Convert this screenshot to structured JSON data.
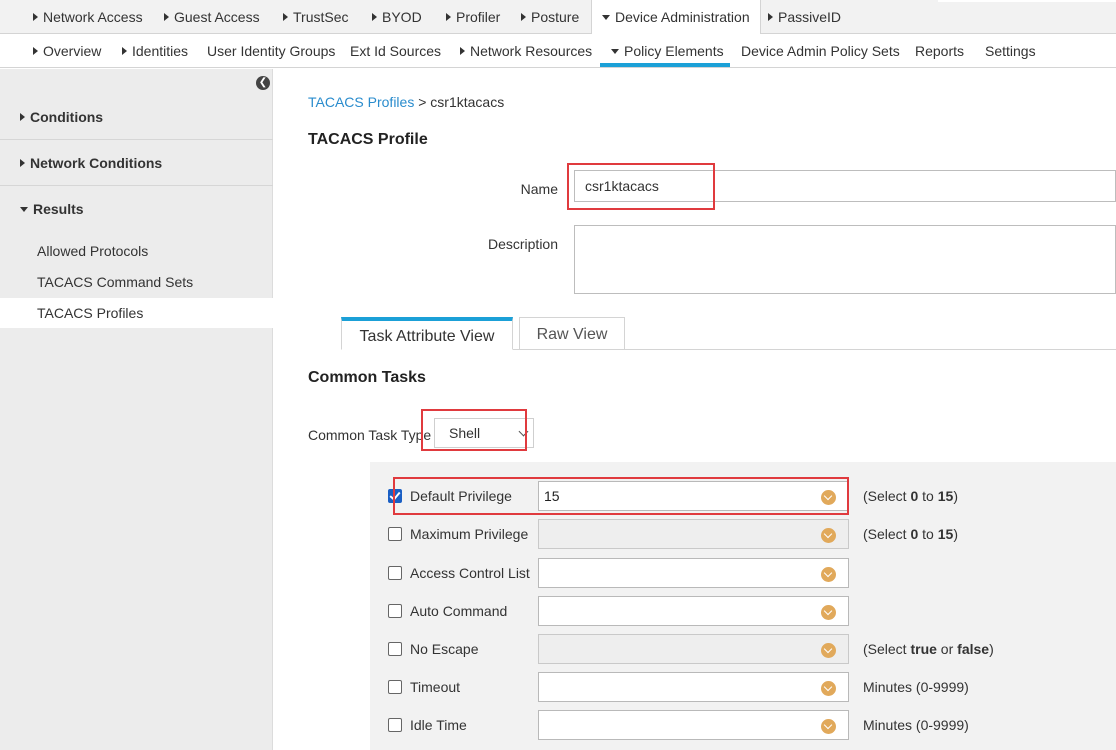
{
  "top_nav": {
    "items": [
      {
        "label": "Network Access"
      },
      {
        "label": "Guest Access"
      },
      {
        "label": "TrustSec"
      },
      {
        "label": "BYOD"
      },
      {
        "label": "Profiler"
      },
      {
        "label": "Posture"
      },
      {
        "label": "Device Administration",
        "active": true
      },
      {
        "label": "PassiveID"
      }
    ]
  },
  "sub_nav": {
    "items": [
      {
        "label": "Overview"
      },
      {
        "label": "Identities"
      },
      {
        "label": "User Identity Groups"
      },
      {
        "label": "Ext Id Sources"
      },
      {
        "label": "Network Resources"
      },
      {
        "label": "Policy Elements",
        "active": true
      },
      {
        "label": "Device Admin Policy Sets"
      },
      {
        "label": "Reports"
      },
      {
        "label": "Settings"
      }
    ],
    "accent_color": "#1ba0d7"
  },
  "sidebar": {
    "sections": [
      {
        "label": "Conditions"
      },
      {
        "label": "Network Conditions"
      },
      {
        "label": "Results"
      }
    ],
    "results_items": [
      {
        "label": "Allowed Protocols"
      },
      {
        "label": "TACACS Command Sets"
      },
      {
        "label": "TACACS Profiles",
        "selected": true
      }
    ]
  },
  "breadcrumb": {
    "parent": "TACACS Profiles",
    "separator": ">",
    "current": "csr1ktacacs"
  },
  "profile": {
    "title": "TACACS Profile",
    "name_label": "Name",
    "name_value": "csr1ktacacs",
    "description_label": "Description",
    "description_value": ""
  },
  "tabs": [
    {
      "label": "Task Attribute View",
      "active": true
    },
    {
      "label": "Raw View"
    }
  ],
  "common_tasks": {
    "title": "Common Tasks",
    "type_label": "Common Task Type",
    "type_value": "Shell",
    "rows": [
      {
        "label": "Default Privilege",
        "checked": true,
        "value": "15",
        "enabled": true,
        "hint_pre": "(Select ",
        "hint_b1": "0",
        "hint_mid": " to ",
        "hint_b2": "15",
        "hint_post": ")"
      },
      {
        "label": "Maximum Privilege",
        "checked": false,
        "value": "",
        "enabled": false,
        "hint_pre": "(Select ",
        "hint_b1": "0",
        "hint_mid": " to ",
        "hint_b2": "15",
        "hint_post": ")"
      },
      {
        "label": "Access Control List",
        "checked": false,
        "value": "",
        "enabled": true,
        "hint_text": ""
      },
      {
        "label": "Auto Command",
        "checked": false,
        "value": "",
        "enabled": true,
        "hint_text": ""
      },
      {
        "label": "No Escape",
        "checked": false,
        "value": "",
        "enabled": false,
        "hint_pre": "(Select ",
        "hint_b1": "true",
        "hint_mid": " or ",
        "hint_b2": "false",
        "hint_post": ")"
      },
      {
        "label": "Timeout",
        "checked": false,
        "value": "",
        "enabled": true,
        "hint_text": "Minutes (0-9999)"
      },
      {
        "label": "Idle Time",
        "checked": false,
        "value": "",
        "enabled": true,
        "hint_text": "Minutes (0-9999)"
      }
    ]
  },
  "colors": {
    "highlight_box": "#e03a3e",
    "link": "#2a8ccd",
    "checkbox_checked": "#1a5fc4",
    "dropdown_icon": "#e1a95b"
  }
}
